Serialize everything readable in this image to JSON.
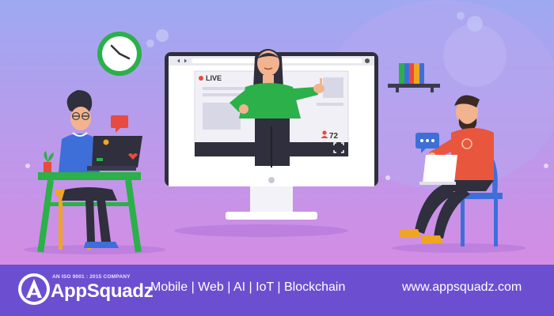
{
  "stream": {
    "live_label": "LIVE",
    "viewer_count": "72"
  },
  "footer": {
    "iso_label": "AN ISO 9001 : 2015 COMPANY",
    "brand_name": "AppSquadz",
    "services": "Mobile | Web | AI | IoT | Blockchain",
    "website": "www.appsquadz.com"
  },
  "colors": {
    "footer_bg": "#6c4fd0",
    "live_dot": "#e84a3f",
    "presenter_shirt": "#2bb04a"
  },
  "icons": {
    "clock": "wall-clock-icon",
    "chat_left": "chat-bubble-icon",
    "chat_right": "typing-bubble-icon",
    "viewers": "user-icon",
    "fullscreen": "fullscreen-icon"
  }
}
